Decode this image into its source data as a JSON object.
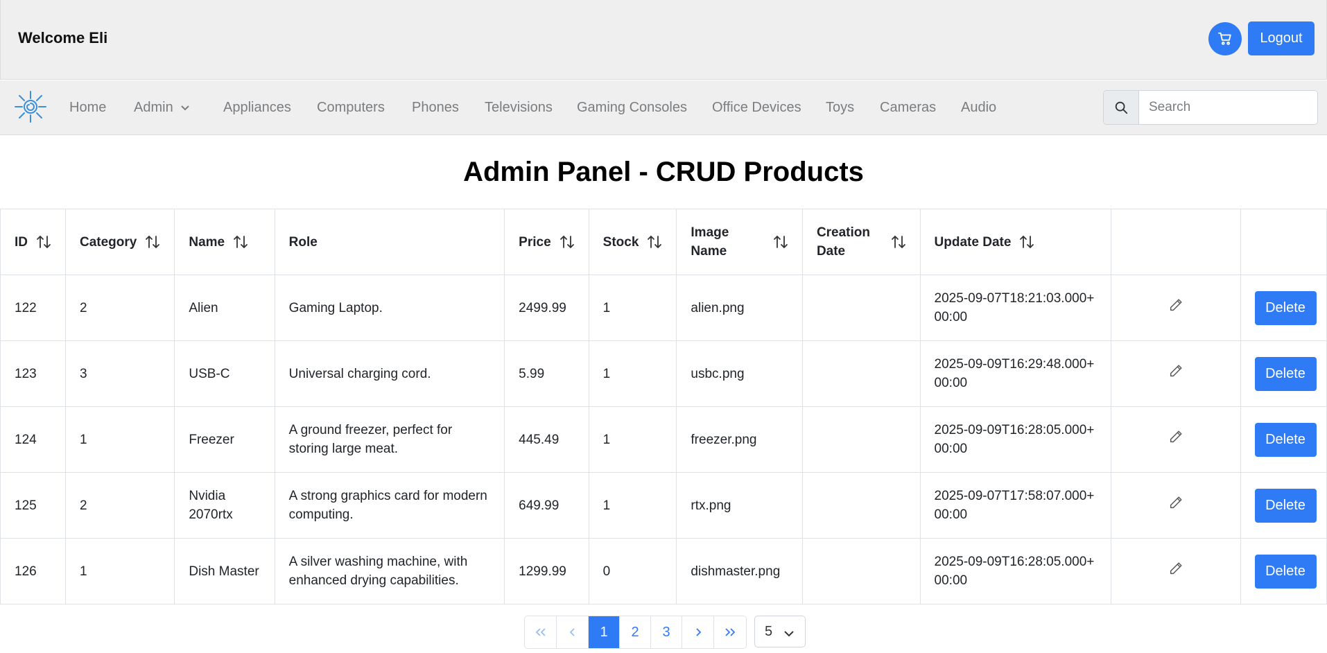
{
  "header": {
    "welcome": "Welcome Eli",
    "logout_label": "Logout",
    "cart_icon": "cart-icon"
  },
  "nav": {
    "items": [
      "Home",
      "Admin",
      "Appliances",
      "Computers",
      "Phones",
      "Televisions",
      "Gaming Consoles",
      "Office Devices",
      "Toys",
      "Cameras",
      "Audio"
    ],
    "search_placeholder": "Search"
  },
  "page": {
    "title": "Admin Panel - CRUD Products"
  },
  "table": {
    "headers": [
      "ID",
      "Category",
      "Name",
      "Role",
      "Price",
      "Stock",
      "Image Name",
      "Creation Date",
      "Update Date",
      "",
      ""
    ],
    "delete_label": "Delete",
    "rows": [
      {
        "id": "122",
        "category": "2",
        "name": "Alien",
        "role": "Gaming Laptop.",
        "price": "2499.99",
        "stock": "1",
        "image": "alien.png",
        "created": "",
        "updated": "2025-09-07T18:21:03.000+00:00"
      },
      {
        "id": "123",
        "category": "3",
        "name": "USB-C",
        "role": "Universal charging cord.",
        "price": "5.99",
        "stock": "1",
        "image": "usbc.png",
        "created": "",
        "updated": "2025-09-09T16:29:48.000+00:00"
      },
      {
        "id": "124",
        "category": "1",
        "name": "Freezer",
        "role": "A ground freezer, perfect for storing large meat.",
        "price": "445.49",
        "stock": "1",
        "image": "freezer.png",
        "created": "",
        "updated": "2025-09-09T16:28:05.000+00:00"
      },
      {
        "id": "125",
        "category": "2",
        "name": "Nvidia 2070rtx",
        "role": "A strong graphics card for modern computing.",
        "price": "649.99",
        "stock": "1",
        "image": "rtx.png",
        "created": "",
        "updated": "2025-09-07T17:58:07.000+00:00"
      },
      {
        "id": "126",
        "category": "1",
        "name": "Dish Master",
        "role": "A silver washing machine, with enhanced drying capabilities.",
        "price": "1299.99",
        "stock": "0",
        "image": "dishmaster.png",
        "created": "",
        "updated": "2025-09-09T16:28:05.000+00:00"
      }
    ]
  },
  "pagination": {
    "pages": [
      "1",
      "2",
      "3"
    ],
    "current": "1",
    "page_size": "5"
  },
  "colors": {
    "primary": "#2f7bf5",
    "header_bg": "#efefef"
  }
}
